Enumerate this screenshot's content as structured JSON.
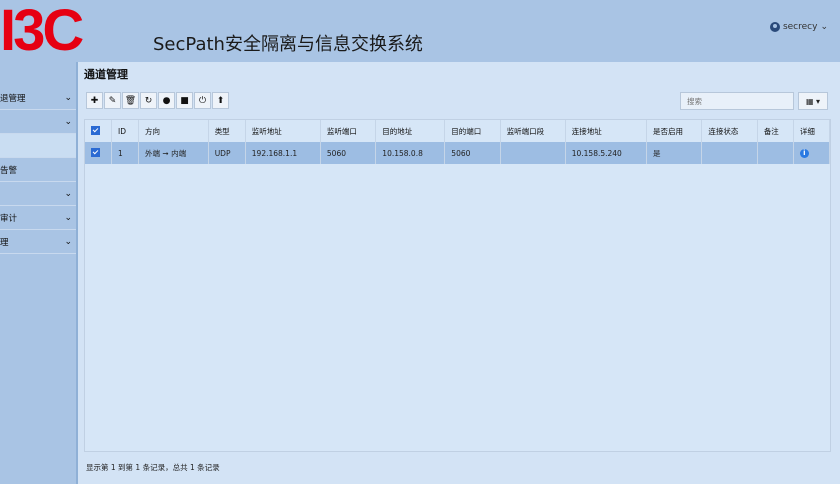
{
  "header": {
    "logo": "I3C",
    "title": "SecPath安全隔离与信息交换系统",
    "user": "secrecy"
  },
  "sidebar": {
    "items": [
      {
        "label": "退管理",
        "chevron": true
      },
      {
        "label": "",
        "chevron": true
      },
      {
        "label": "",
        "chevron": false,
        "active": true
      },
      {
        "label": "告警",
        "chevron": false
      },
      {
        "label": "",
        "chevron": true
      },
      {
        "label": "审计",
        "chevron": true
      },
      {
        "label": "理",
        "chevron": true
      }
    ]
  },
  "main": {
    "title": "通道管理",
    "search_placeholder": "搜索",
    "toolbar_icons": [
      "plus-icon",
      "edit-icon",
      "delete-icon",
      "refresh-icon",
      "start-icon",
      "stop-icon",
      "power-icon",
      "upload-icon"
    ],
    "footer": "显示第 1 到第 1 条记录，总共 1 条记录"
  },
  "table": {
    "columns": [
      "ID",
      "方向",
      "类型",
      "监听地址",
      "监听端口",
      "目的地址",
      "目的端口",
      "监听端口段",
      "连接地址",
      "是否启用",
      "连接状态",
      "备注",
      "详细"
    ],
    "rows": [
      {
        "id": "1",
        "direction": "外端 ➞ 内端",
        "type": "UDP",
        "listen_addr": "192.168.1.1",
        "listen_port": "5060",
        "dest_addr": "10.158.0.8",
        "dest_port": "5060",
        "port_range": "",
        "conn_addr": "10.158.5.240",
        "enabled": "是",
        "status": "",
        "note": ""
      }
    ]
  },
  "colors": {
    "background": "#a9c4e4",
    "main": "#d3e3f5",
    "selected_row": "#9dbde3",
    "logo": "#e60012",
    "accent": "#2a7ae2"
  }
}
